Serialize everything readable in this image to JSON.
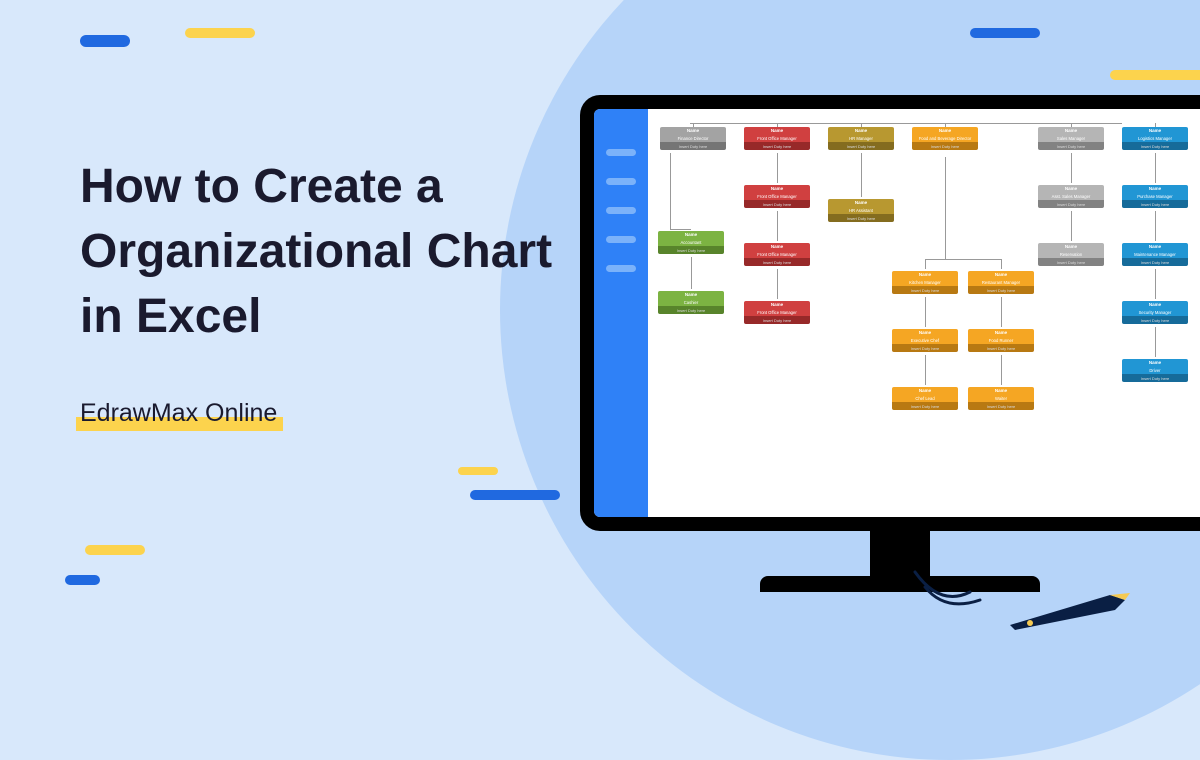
{
  "text": {
    "title": "How to Create a Organizational Chart in Excel",
    "subtitle": "EdrawMax Online"
  },
  "org_chart": {
    "node_template": {
      "name_label": "Name",
      "duty_label": "Insert Duty here"
    },
    "columns": [
      {
        "color": "grey",
        "top_role": "Finance Director",
        "children": [
          {
            "color": "green",
            "role": "Accountant"
          },
          {
            "color": "green",
            "role": "Cashier"
          }
        ]
      },
      {
        "color": "red",
        "top_role": "Front Office Manager",
        "children": [
          {
            "color": "red",
            "role": "Front Office Manager"
          },
          {
            "color": "red",
            "role": "Front Office Manager"
          },
          {
            "color": "red",
            "role": "Front Office Manager"
          }
        ]
      },
      {
        "color": "olive",
        "top_role": "HR Manager",
        "children": [
          {
            "color": "olive",
            "role": "HR Assistant"
          }
        ]
      },
      {
        "color": "orange",
        "top_role": "Food and Beverage Director",
        "children_split": {
          "left": [
            {
              "color": "orange",
              "role": "Kitchen Manager"
            },
            {
              "color": "orange",
              "role": "Executive Chef"
            },
            {
              "color": "orange",
              "role": "Chef Lead"
            }
          ],
          "right": [
            {
              "color": "orange",
              "role": "Restaurant Manager"
            },
            {
              "color": "orange",
              "role": "Food Runner"
            },
            {
              "color": "orange",
              "role": "Waiter"
            }
          ]
        }
      },
      {
        "color": "grey2",
        "top_role": "Sales Manager",
        "children": [
          {
            "color": "grey2",
            "role": "Asst. Sales Manager"
          },
          {
            "color": "grey2",
            "role": "Reservation"
          }
        ]
      },
      {
        "color": "blue",
        "top_role": "Logistics Manager",
        "children": [
          {
            "color": "blue",
            "role": "Purchase Manager"
          },
          {
            "color": "blue",
            "role": "Maintenance Manager"
          },
          {
            "color": "blue",
            "role": "Security Manager"
          },
          {
            "color": "blue",
            "role": "Driver"
          }
        ]
      }
    ]
  },
  "colors": {
    "bg": "#d8e8fb",
    "circle": "#b6d4f9",
    "blue": "#2069e0",
    "yellow": "#fcd34d",
    "sidebar": "#2f81f7"
  }
}
